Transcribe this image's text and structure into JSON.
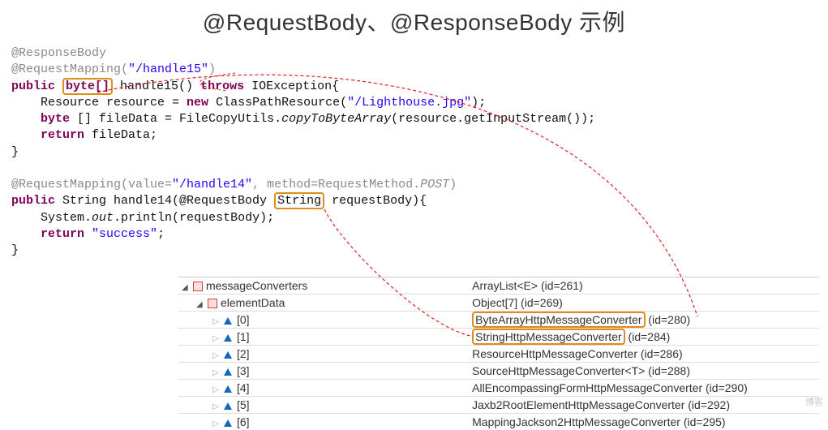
{
  "title": "@RequestBody、@ResponseBody 示例",
  "code": {
    "l1": "@ResponseBody",
    "l2a": "@RequestMapping(",
    "l2b": "\"/handle15\"",
    "l2c": ")",
    "l3a": "public",
    "l3b": "byte[]",
    "l3c": " handle15() ",
    "l3d": "throws",
    "l3e": " IOException{",
    "l4a": "    Resource resource = ",
    "l4b": "new",
    "l4c": " ClassPathResource(",
    "l4d": "\"/Lighthouse.jpg\"",
    "l4e": ");",
    "l5a": "    ",
    "l5b": "byte",
    "l5c": " [] fileData = FileCopyUtils.",
    "l5d": "copyToByteArray",
    "l5e": "(resource.getInputStream());",
    "l6a": "    ",
    "l6b": "return",
    "l6c": " fileData;",
    "l7": "}",
    "l8": "",
    "l9a": "@RequestMapping(value=",
    "l9b": "\"/handle14\"",
    "l9c": ", method=RequestMethod.",
    "l9d": "POST",
    "l9e": ")",
    "l10a": "public",
    "l10b": " String handle14(@RequestBody ",
    "l10c": "String",
    "l10d": " requestBody){",
    "l11a": "    System.",
    "l11b": "out",
    "l11c": ".println(requestBody);",
    "l12a": "    ",
    "l12b": "return",
    "l12c": " ",
    "l12d": "\"success\"",
    "l12e": ";",
    "l13": "}"
  },
  "tree": {
    "rows": [
      {
        "indent": 0,
        "expand": "open",
        "icon": "sq",
        "name": "messageConverters",
        "value": "ArrayList<E>  (id=261)",
        "box": false
      },
      {
        "indent": 1,
        "expand": "open",
        "icon": "sq",
        "name": "elementData",
        "value": "Object[7]  (id=269)",
        "box": false
      },
      {
        "indent": 2,
        "expand": "closed",
        "icon": "up",
        "name": "[0]",
        "value": "ByteArrayHttpMessageConverter  (id=280)",
        "box": true
      },
      {
        "indent": 2,
        "expand": "closed",
        "icon": "up",
        "name": "[1]",
        "value": "StringHttpMessageConverter  (id=284)",
        "box": true
      },
      {
        "indent": 2,
        "expand": "closed",
        "icon": "up",
        "name": "[2]",
        "value": "ResourceHttpMessageConverter  (id=286)",
        "box": false
      },
      {
        "indent": 2,
        "expand": "closed",
        "icon": "up",
        "name": "[3]",
        "value": "SourceHttpMessageConverter<T>  (id=288)",
        "box": false
      },
      {
        "indent": 2,
        "expand": "closed",
        "icon": "up",
        "name": "[4]",
        "value": "AllEncompassingFormHttpMessageConverter  (id=290)",
        "box": false
      },
      {
        "indent": 2,
        "expand": "closed",
        "icon": "up",
        "name": "[5]",
        "value": "Jaxb2RootElementHttpMessageConverter  (id=292)",
        "box": false
      },
      {
        "indent": 2,
        "expand": "closed",
        "icon": "up",
        "name": "[6]",
        "value": "MappingJackson2HttpMessageConverter  (id=295)",
        "box": false
      }
    ]
  },
  "watermark": "博客"
}
